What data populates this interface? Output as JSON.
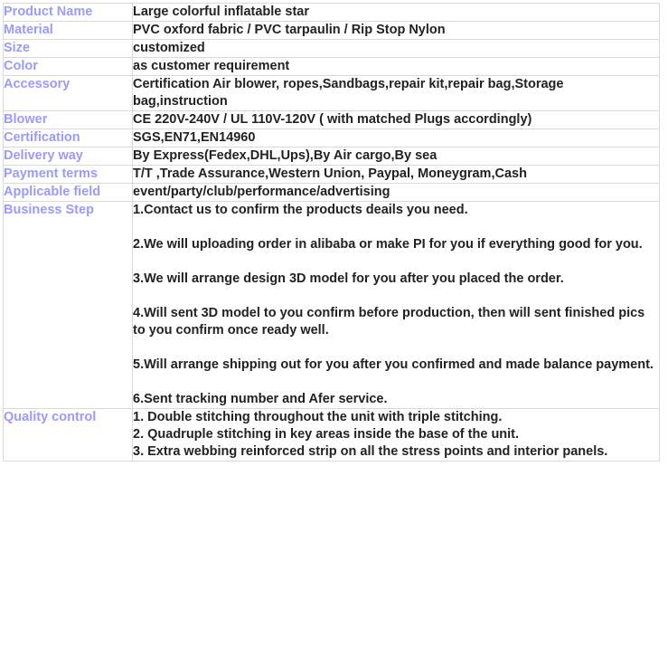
{
  "table": {
    "rows": [
      {
        "label": "Product Name",
        "lines": [
          "Large colorful inflatable star"
        ],
        "spacing": "tight"
      },
      {
        "label": "Material",
        "lines": [
          "PVC oxford fabric / PVC tarpaulin / Rip Stop Nylon"
        ],
        "spacing": "tight"
      },
      {
        "label": "Size",
        "lines": [
          "customized"
        ],
        "spacing": "tight"
      },
      {
        "label": "Color",
        "lines": [
          "as customer requirement"
        ],
        "spacing": "tight"
      },
      {
        "label": "Accessory",
        "lines": [
          "Certification Air blower, ropes,Sandbags,repair kit,repair bag,Storage bag,instruction"
        ],
        "spacing": "tight"
      },
      {
        "label": "Blower",
        "lines": [
          "CE 220V-240V / UL 110V-120V ( with matched Plugs accordingly)"
        ],
        "spacing": "tight"
      },
      {
        "label": "Certification",
        "lines": [
          "SGS,EN71,EN14960"
        ],
        "spacing": "tight"
      },
      {
        "label": "Delivery way",
        "lines": [
          "By Express(Fedex,DHL,Ups),By Air cargo,By sea"
        ],
        "spacing": "tight"
      },
      {
        "label": "Payment terms",
        "lines": [
          "T/T ,Trade Assurance,Western Union, Paypal, Moneygram,Cash"
        ],
        "spacing": "tight"
      },
      {
        "label": "Applicable field",
        "lines": [
          "event/party/club/performance/advertising"
        ],
        "spacing": "tight"
      },
      {
        "label": "Business Step",
        "lines": [
          "1.Contact us to confirm the products deails you need.",
          "2.We will uploading order in alibaba or make PI for you if everything good for you.",
          "3.We will arrange design 3D model for you after you placed the order.",
          "4.Will sent 3D model to you confirm before production, then will sent finished pics to you confirm once ready well.",
          "5.Will arrange shipping out for you after you confirmed and made balance payment.",
          "6.Sent tracking number and Afer service."
        ],
        "spacing": "spaced"
      },
      {
        "label": "Quality control",
        "lines": [
          "1. Double stitching throughout the unit with triple stitching.",
          "2. Quadruple stitching in key areas inside the base of the unit.",
          "3. Extra webbing reinforced strip on all the stress points and interior panels."
        ],
        "spacing": "tight"
      }
    ]
  },
  "colors": {
    "label_text": "#9a9aff",
    "value_text": "#222222",
    "border": "#d9d9d9",
    "background": "#ffffff"
  }
}
